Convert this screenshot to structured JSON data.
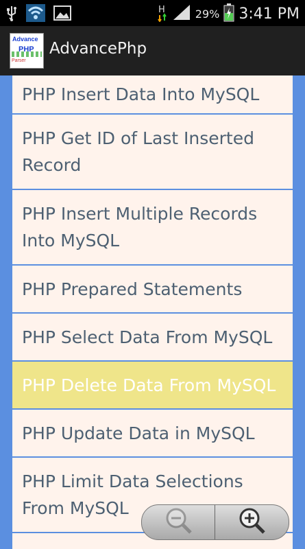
{
  "status_bar": {
    "icons": [
      "usb-icon",
      "wifi-icon",
      "image-icon",
      "network-h-icon",
      "signal-icon",
      "battery-charging-icon"
    ],
    "battery_percent": "29%",
    "time": "3:41 PM"
  },
  "action_bar": {
    "app_icon_text": {
      "line1": "Advance",
      "line2": "PHP",
      "line3": "Parser"
    },
    "title": "AdvancePhp"
  },
  "list": {
    "items": [
      {
        "label": "PHP Insert Data Into MySQL",
        "selected": false
      },
      {
        "label": "PHP Get ID of Last Inserted Record",
        "selected": false
      },
      {
        "label": "PHP Insert Multiple Records Into MySQL",
        "selected": false
      },
      {
        "label": "PHP Prepared Statements",
        "selected": false
      },
      {
        "label": "PHP Select Data From MySQL",
        "selected": false
      },
      {
        "label": "PHP Delete Data From MySQL",
        "selected": true
      },
      {
        "label": "PHP Update Data in MySQL",
        "selected": false
      },
      {
        "label": "PHP Limit Data Selections From MySQL",
        "selected": false
      }
    ]
  },
  "zoom_control": {
    "zoom_out_icon": "zoom-out-icon",
    "zoom_in_icon": "zoom-in-icon"
  },
  "colors": {
    "background_blue": "#5b8fe0",
    "item_bg": "#fff3ec",
    "selected_bg": "#efe58a",
    "item_text": "#4d6072"
  }
}
